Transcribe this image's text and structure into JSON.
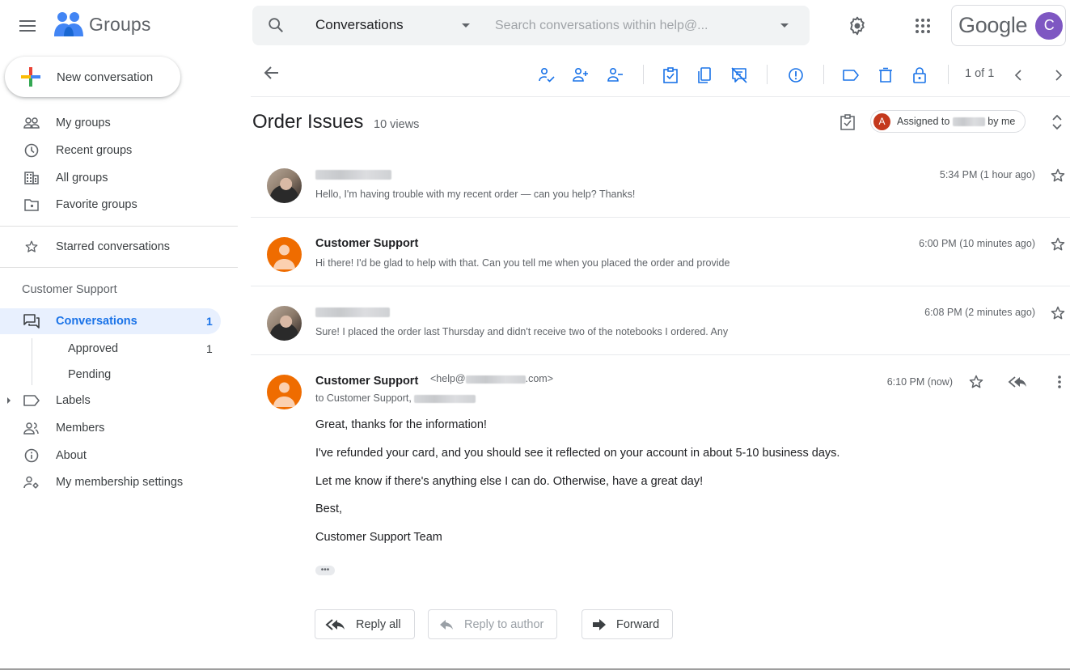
{
  "app": {
    "name": "Groups",
    "brand_colors": {
      "blue": "#1a73e8",
      "red": "#ea4335",
      "yellow": "#fbbc04",
      "green": "#34a853"
    }
  },
  "header": {
    "search_scope": "Conversations",
    "search_placeholder": "Search conversations within help@...",
    "search_value": "",
    "account_brand": "Google",
    "account_initial": "C",
    "account_color": "#7e57c2"
  },
  "sidebar": {
    "new_conversation_label": "New conversation",
    "top_items": [
      {
        "label": "My groups",
        "icon": "people-icon"
      },
      {
        "label": "Recent groups",
        "icon": "clock-icon"
      },
      {
        "label": "All groups",
        "icon": "building-icon"
      },
      {
        "label": "Favorite groups",
        "icon": "folder-star-icon"
      }
    ],
    "starred_label": "Starred conversations",
    "group_name": "Customer Support",
    "group_items": [
      {
        "label": "Conversations",
        "count": "1",
        "active": true,
        "icon": "forum-icon"
      },
      {
        "label": "Approved",
        "count": "1",
        "sub": true
      },
      {
        "label": "Pending",
        "count": "",
        "sub": true
      },
      {
        "label": "Labels",
        "icon": "label-icon",
        "expandable": true
      },
      {
        "label": "Members",
        "icon": "members-icon"
      },
      {
        "label": "About",
        "icon": "info-icon"
      },
      {
        "label": "My membership settings",
        "icon": "member-settings-icon"
      }
    ]
  },
  "toolbar": {
    "back_label": "Back",
    "actions": [
      "assign-to-me",
      "assign",
      "unassign",
      "mark-complete",
      "duplicate",
      "mark-no-action-needed",
      "report-spam",
      "add-label",
      "delete",
      "lock"
    ],
    "pager": "1 of 1"
  },
  "conversation": {
    "title": "Order Issues",
    "views": "10 views",
    "assigned_prefix": "Assigned to",
    "assigned_suffix": "by me",
    "assigned_initial": "A",
    "messages": [
      {
        "sender": "",
        "sender_redacted": true,
        "snippet": "Hello, I'm having trouble with my recent order — can you help? Thanks!",
        "time": "5:34 PM (1 hour ago)"
      },
      {
        "sender": "Customer Support",
        "sender_redacted": false,
        "snippet": "Hi there! I'd be glad to help with that. Can you tell me when you placed the order and provide",
        "time": "6:00 PM (10 minutes ago)"
      },
      {
        "sender": "",
        "sender_redacted": true,
        "snippet": "Sure! I placed the order last Thursday and didn't receive two of the notebooks I ordered. Any",
        "time": "6:08 PM (2 minutes ago)"
      }
    ],
    "expanded": {
      "sender": "Customer Support",
      "email_prefix": "<help@",
      "email_suffix": ".com>",
      "to_prefix": "to Customer Support,",
      "time": "6:10 PM (now)",
      "body": [
        "Great, thanks for the information!",
        "I've refunded your card, and you should see it reflected on your account in about 5-10 business days.",
        "Let me know if there's anything else I can do. Otherwise, have a great day!",
        "Best,",
        "Customer Support Team"
      ],
      "show_trimmed": "•••"
    },
    "actions": {
      "reply_all": "Reply all",
      "reply_author": "Reply to author",
      "forward": "Forward"
    }
  }
}
